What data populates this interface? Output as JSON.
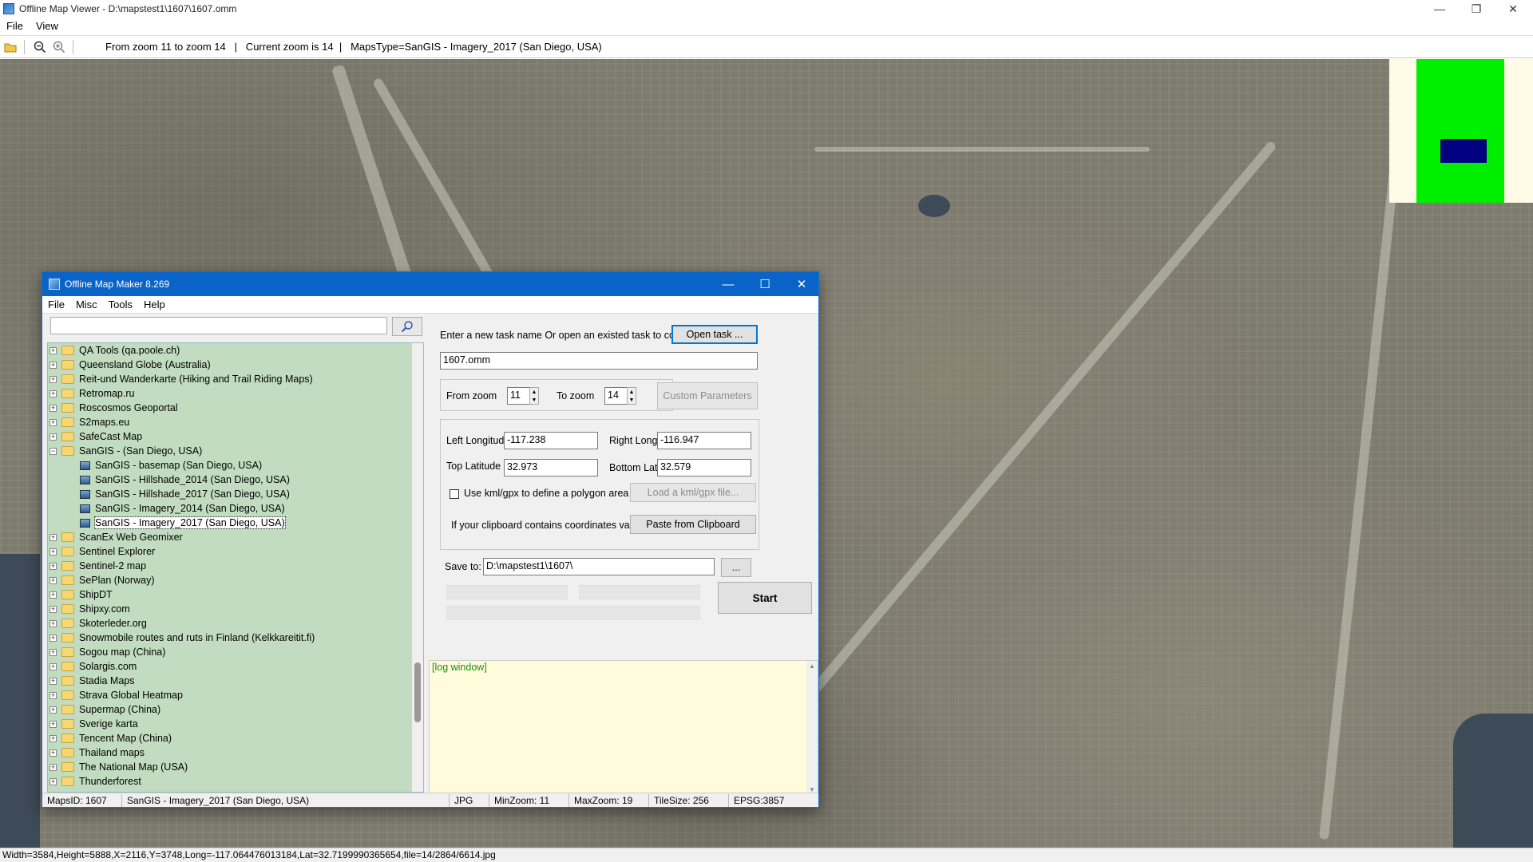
{
  "viewer": {
    "title": "Offline Map Viewer - D:\\mapstest1\\1607\\1607.omm",
    "menu": [
      "File",
      "View"
    ],
    "toolbar_info": "From zoom 11 to zoom 14   |   Current zoom is 14  |   MapsType=SanGIS - Imagery_2017 (San Diego, USA)",
    "status": "Width=3584,Height=5888,X=2116,Y=3748,Long=-117.064476013184,Lat=32.7199990365654,file=14/2864/6614.jpg",
    "controls": {
      "minimize": "—",
      "restore": "❐",
      "close": "✕"
    },
    "icons": [
      "open-folder-icon",
      "zoom-out-icon",
      "zoom-in-icon"
    ]
  },
  "dialog": {
    "title": "Offline Map Maker 8.269",
    "menu": [
      "File",
      "Misc",
      "Tools",
      "Help"
    ],
    "controls": {
      "minimize": "—",
      "maximize": "☐",
      "close": "✕"
    },
    "search": {
      "value": "",
      "placeholder": ""
    },
    "tree": [
      {
        "label": "QA Tools (qa.poole.ch)",
        "type": "folder",
        "expander": "+"
      },
      {
        "label": "Queensland Globe (Australia)",
        "type": "folder",
        "expander": "+"
      },
      {
        "label": "Reit-und Wanderkarte (Hiking and Trail Riding Maps)",
        "type": "folder",
        "expander": "+"
      },
      {
        "label": "Retromap.ru",
        "type": "folder",
        "expander": "+"
      },
      {
        "label": "Roscosmos Geoportal",
        "type": "folder",
        "expander": "+"
      },
      {
        "label": "S2maps.eu",
        "type": "folder",
        "expander": "+"
      },
      {
        "label": "SafeCast Map",
        "type": "folder",
        "expander": "+"
      },
      {
        "label": "SanGIS - (San Diego, USA)",
        "type": "folder-open",
        "expander": "−"
      },
      {
        "label": "SanGIS - basemap (San Diego, USA)",
        "type": "map"
      },
      {
        "label": "SanGIS - Hillshade_2014 (San Diego, USA)",
        "type": "map"
      },
      {
        "label": "SanGIS - Hillshade_2017 (San Diego, USA)",
        "type": "map"
      },
      {
        "label": "SanGIS - Imagery_2014 (San Diego, USA)",
        "type": "map"
      },
      {
        "label": "SanGIS - Imagery_2017 (San Diego, USA)",
        "type": "map",
        "selected": true
      },
      {
        "label": "ScanEx Web Geomixer",
        "type": "folder",
        "expander": "+"
      },
      {
        "label": "Sentinel Explorer",
        "type": "folder",
        "expander": "+"
      },
      {
        "label": "Sentinel-2 map",
        "type": "folder",
        "expander": "+"
      },
      {
        "label": "SePlan (Norway)",
        "type": "folder",
        "expander": "+"
      },
      {
        "label": "ShipDT",
        "type": "folder",
        "expander": "+"
      },
      {
        "label": "Shipxy.com",
        "type": "folder",
        "expander": "+"
      },
      {
        "label": "Skoterleder.org",
        "type": "folder",
        "expander": "+"
      },
      {
        "label": "Snowmobile routes and ruts in Finland (Kelkkareitit.fi)",
        "type": "folder",
        "expander": "+"
      },
      {
        "label": "Sogou map (China)",
        "type": "folder",
        "expander": "+"
      },
      {
        "label": "Solargis.com",
        "type": "folder",
        "expander": "+"
      },
      {
        "label": "Stadia Maps",
        "type": "folder",
        "expander": "+"
      },
      {
        "label": "Strava Global Heatmap",
        "type": "folder",
        "expander": "+"
      },
      {
        "label": "Supermap (China)",
        "type": "folder",
        "expander": "+"
      },
      {
        "label": "Sverige karta",
        "type": "folder",
        "expander": "+"
      },
      {
        "label": "Tencent Map (China)",
        "type": "folder",
        "expander": "+"
      },
      {
        "label": "Thailand maps",
        "type": "folder",
        "expander": "+"
      },
      {
        "label": "The National Map (USA)",
        "type": "folder",
        "expander": "+"
      },
      {
        "label": "Thunderforest",
        "type": "folder",
        "expander": "+"
      }
    ],
    "task_prompt": "Enter a new task name Or open an existed task to continue:",
    "open_task_label": "Open task ...",
    "task_name": "1607.omm",
    "from_zoom_label": "From zoom",
    "from_zoom": "11",
    "to_zoom_label": "To zoom",
    "to_zoom": "14",
    "custom_params_label": "Custom Parameters",
    "left_lon_label": "Left Longitude",
    "left_lon": "-117.238",
    "right_lon_label": "Right Longitude",
    "right_lon": "-116.947",
    "top_lat_label": "Top Latitude",
    "top_lat": "32.973",
    "bottom_lat_label": "Bottom Latitude",
    "bottom_lat": "32.579",
    "kml_check_label": "Use kml/gpx to define a polygon area",
    "load_kml_label": "Load a kml/gpx file...",
    "clipboard_prompt": "If your clipboard contains coordinates values:",
    "paste_label": "Paste from Clipboard",
    "save_to_label": "Save to:",
    "save_to": "D:\\mapstest1\\1607\\",
    "browse_label": "...",
    "start_label": "Start",
    "log_text": "[log window]",
    "status": {
      "maps_id": "MapsID: 1607",
      "map_name": "SanGIS - Imagery_2017 (San Diego, USA)",
      "format": "JPG",
      "min_zoom": "MinZoom: 11",
      "max_zoom": "MaxZoom: 19",
      "tile_size": "TileSize: 256",
      "epsg": "EPSG:3857"
    }
  }
}
